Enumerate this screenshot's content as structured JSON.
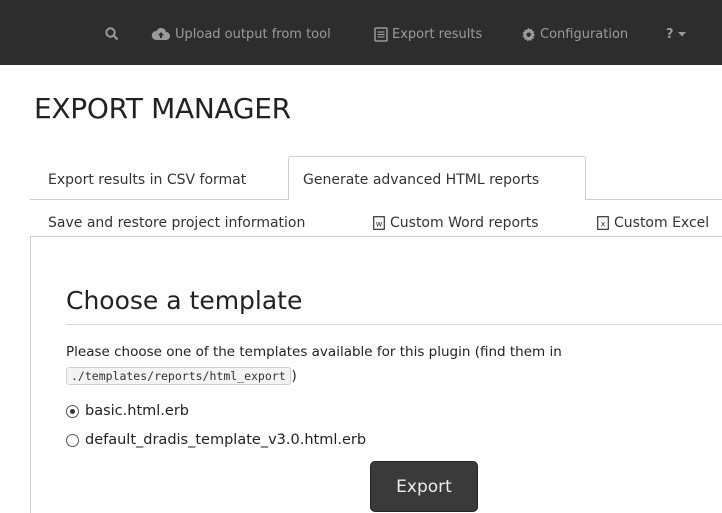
{
  "nav": {
    "upload_label": "Upload output from tool",
    "export_label": "Export results",
    "config_label": "Configuration",
    "help_label": "?"
  },
  "page_title": "EXPORT MANAGER",
  "tabs": [
    {
      "label": "Export results in CSV format",
      "active": false
    },
    {
      "label": "Generate advanced HTML reports",
      "active": true
    },
    {
      "label": "Save and restore project information",
      "active": false
    },
    {
      "label": "Custom Word reports",
      "active": false,
      "icon": "word-file-icon"
    },
    {
      "label": "Custom Excel",
      "active": false,
      "icon": "excel-file-icon"
    }
  ],
  "panel": {
    "heading": "Choose a template",
    "help_text": "Please choose one of the templates available for this plugin (find them in",
    "template_path": "./templates/reports/html_export",
    "help_suffix": ")",
    "templates": [
      {
        "label": "basic.html.erb",
        "selected": true
      },
      {
        "label": "default_dradis_template_v3.0.html.erb",
        "selected": false
      }
    ],
    "export_button": "Export"
  }
}
